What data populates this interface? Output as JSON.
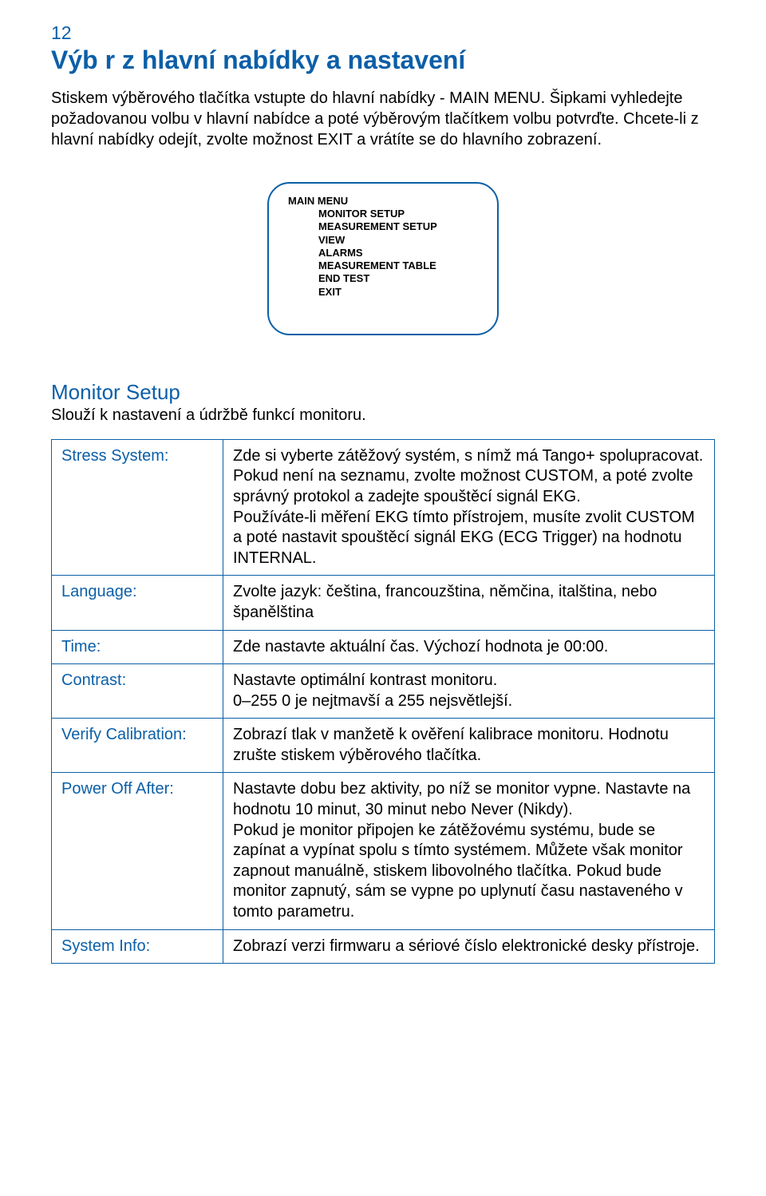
{
  "page_number": "12",
  "title": "Výb r z hlavní nabídky a nastavení",
  "intro": "Stiskem výběrového tlačítka vstupte do hlavní nabídky - MAIN MENU. Šipkami vyhledejte požadovanou volbu v hlavní nabídce a poté výběrovým tlačítkem volbu potvrďte. Chcete-li z hlavní nabídky odejít, zvolte možnost EXIT a vrátíte se do hlavního zobrazení.",
  "menu": {
    "title": "MAIN MENU",
    "items": [
      "MONITOR SETUP",
      "MEASUREMENT SETUP",
      "VIEW",
      "ALARMS",
      "MEASUREMENT TABLE",
      "END TEST",
      "EXIT"
    ]
  },
  "section": {
    "title": "Monitor Setup",
    "subtitle": "Slouží k nastavení a údržbě funkcí monitoru."
  },
  "rows": [
    {
      "label": "Stress System:",
      "text": "Zde si vyberte zátěžový systém, s nímž má Tango+ spolupracovat. Pokud není na seznamu, zvolte možnost CUSTOM, a poté zvolte správný protokol a zadejte spouštěcí signál EKG.\nPoužíváte-li měření EKG tímto přístrojem, musíte zvolit CUSTOM a poté nastavit spouštěcí signál EKG (ECG Trigger) na hodnotu INTERNAL."
    },
    {
      "label": "Language:",
      "text": "Zvolte jazyk: čeština, francouzština, němčina, italština, nebo španělština"
    },
    {
      "label": "Time:",
      "text": "Zde nastavte aktuální čas. Výchozí hodnota je 00:00."
    },
    {
      "label": "Contrast:",
      "text": "Nastavte optimální kontrast monitoru.\n0–255 0 je nejtmavší a 255 nejsvětlejší."
    },
    {
      "label": "Verify Calibration:",
      "text": "Zobrazí tlak v manžetě k ověření kalibrace monitoru. Hodnotu zrušte stiskem výběrového tlačítka."
    },
    {
      "label": "Power Off After:",
      "text": "Nastavte dobu bez aktivity, po níž se monitor vypne. Nastavte na hodnotu 10 minut, 30 minut nebo Never (Nikdy).\nPokud je monitor připojen ke zátěžovému systému, bude se zapínat a vypínat spolu s tímto systémem. Můžete však monitor zapnout manuálně, stiskem libovolného tlačítka. Pokud bude monitor zapnutý, sám se vypne po uplynutí času nastaveného v tomto parametru."
    },
    {
      "label": "System Info:",
      "text": "Zobrazí verzi firmwaru a sériové číslo elektronické desky přístroje."
    }
  ]
}
